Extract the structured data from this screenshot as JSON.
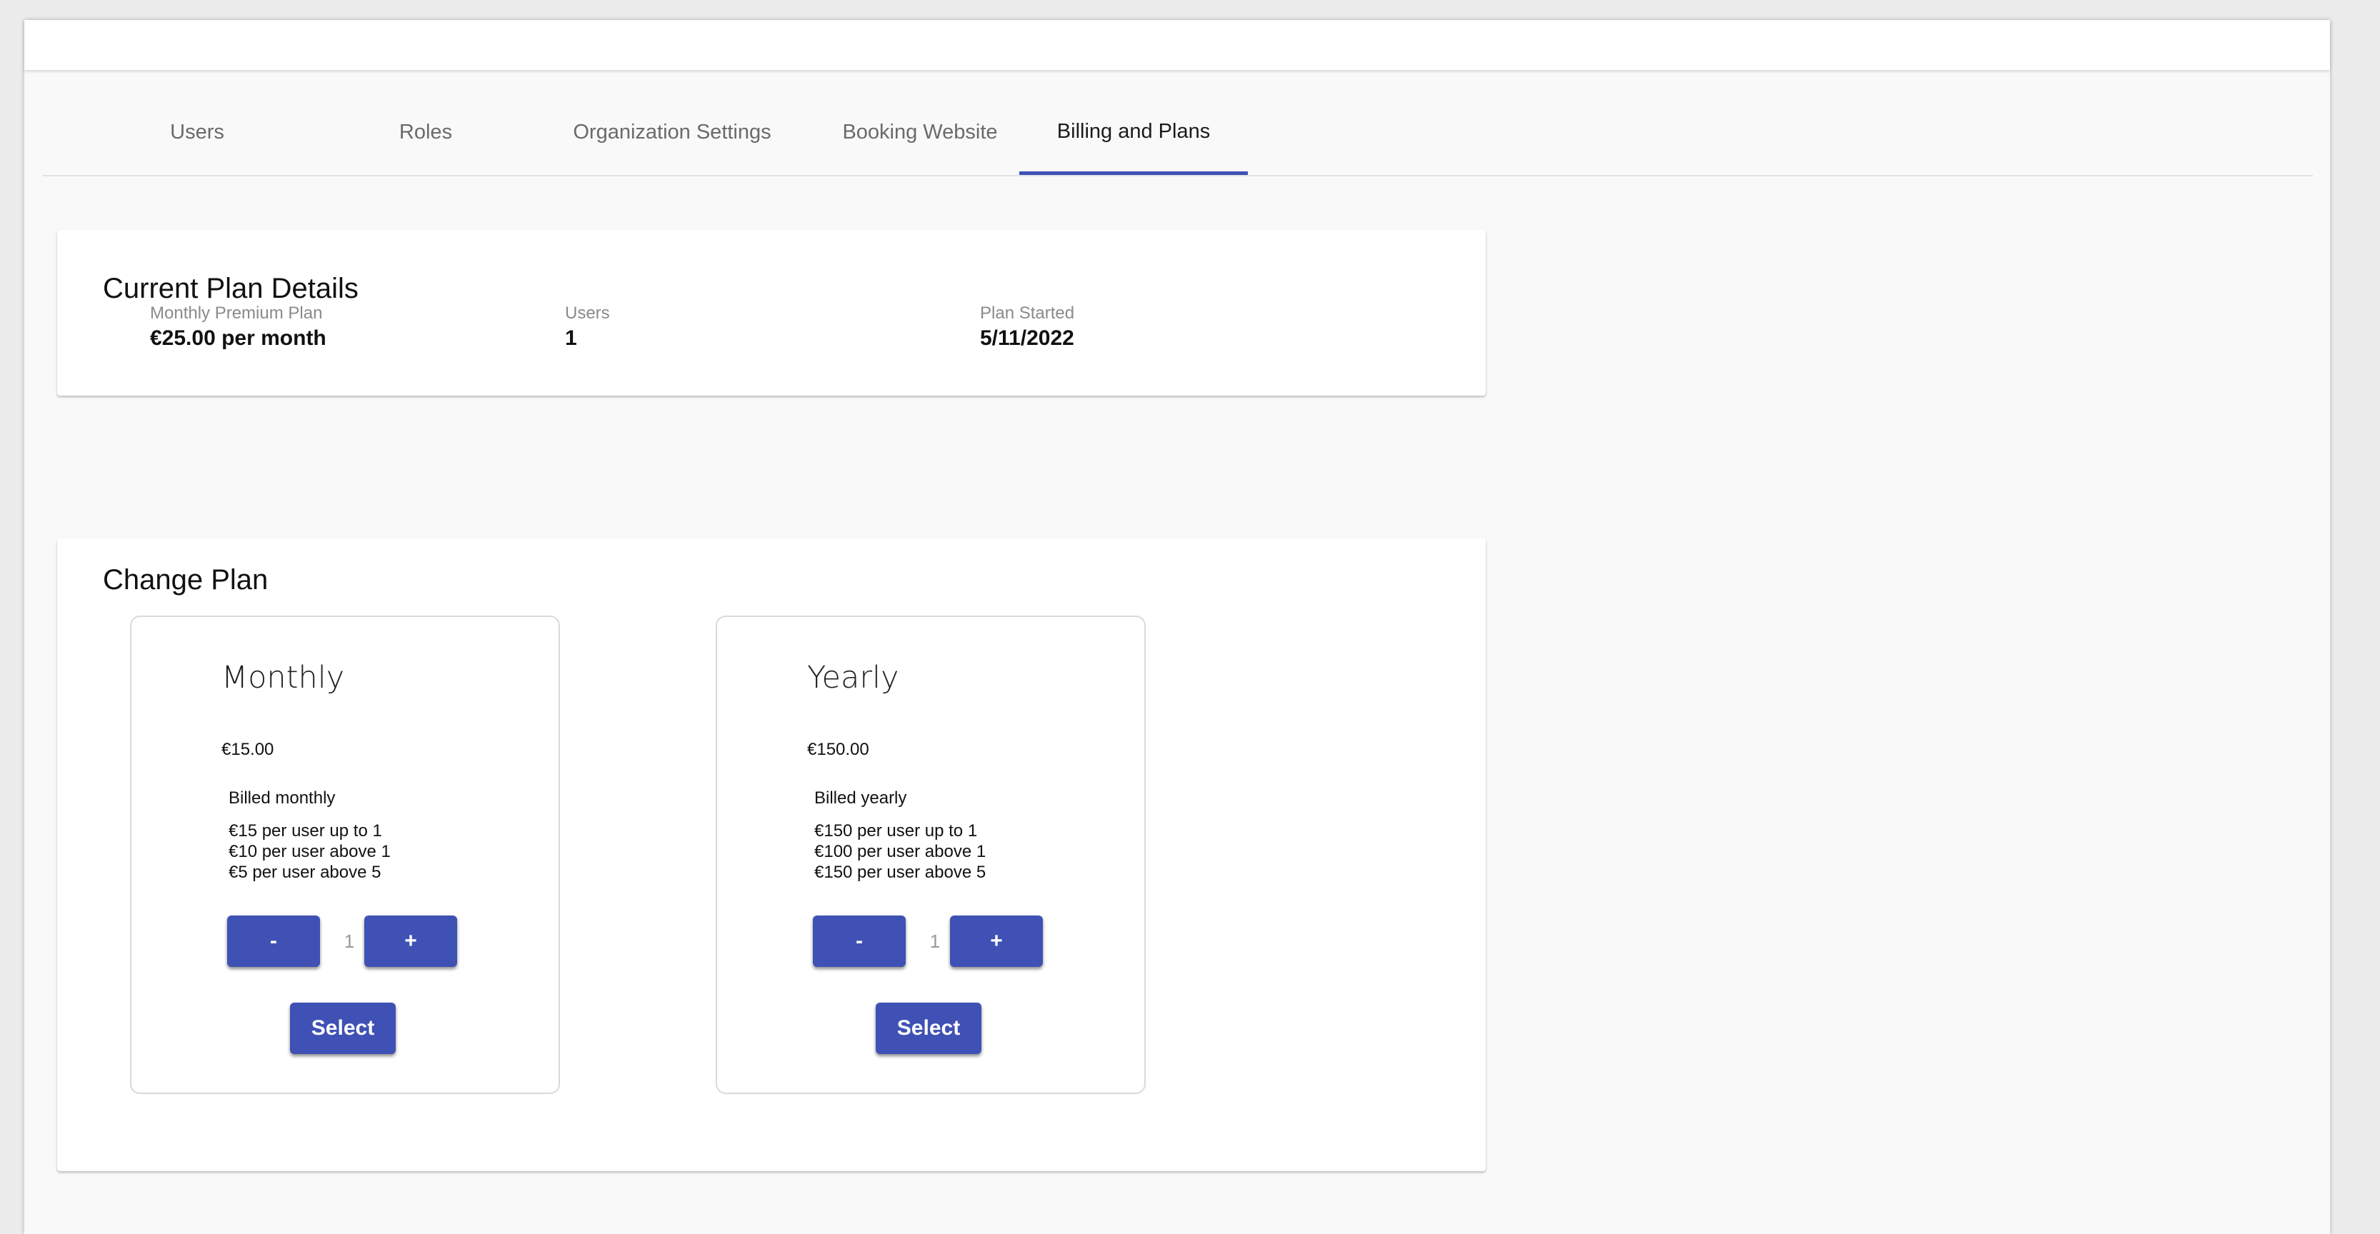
{
  "tabs": [
    {
      "label": "Users"
    },
    {
      "label": "Roles"
    },
    {
      "label": "Organization Settings"
    },
    {
      "label": "Booking Website"
    },
    {
      "label": "Billing and Plans",
      "active": true
    }
  ],
  "current_plan": {
    "title": "Current Plan Details",
    "plan": {
      "label": "Monthly Premium Plan",
      "value": "€25.00 per month"
    },
    "users": {
      "label": "Users",
      "value": "1"
    },
    "started": {
      "label": "Plan Started",
      "value": "5/11/2022"
    }
  },
  "change_plan": {
    "title": "Change Plan",
    "plans": [
      {
        "name": "Monthly",
        "price": "€15.00",
        "billed": "Billed monthly",
        "tiers": [
          "€15 per user up to 1",
          "€10 per user above 1",
          "€5 per user above 5"
        ],
        "minus_label": "-",
        "plus_label": "+",
        "quantity": "1",
        "select_label": "Select"
      },
      {
        "name": "Yearly",
        "price": "€150.00",
        "billed": "Billed yearly",
        "tiers": [
          "€150 per user up to 1",
          "€100 per user above 1",
          "€150 per user above 5"
        ],
        "minus_label": "-",
        "plus_label": "+",
        "quantity": "1",
        "select_label": "Select"
      }
    ]
  },
  "colors": {
    "accent": "#3f51b5",
    "background": "#f9f9f9",
    "card": "#ffffff"
  }
}
